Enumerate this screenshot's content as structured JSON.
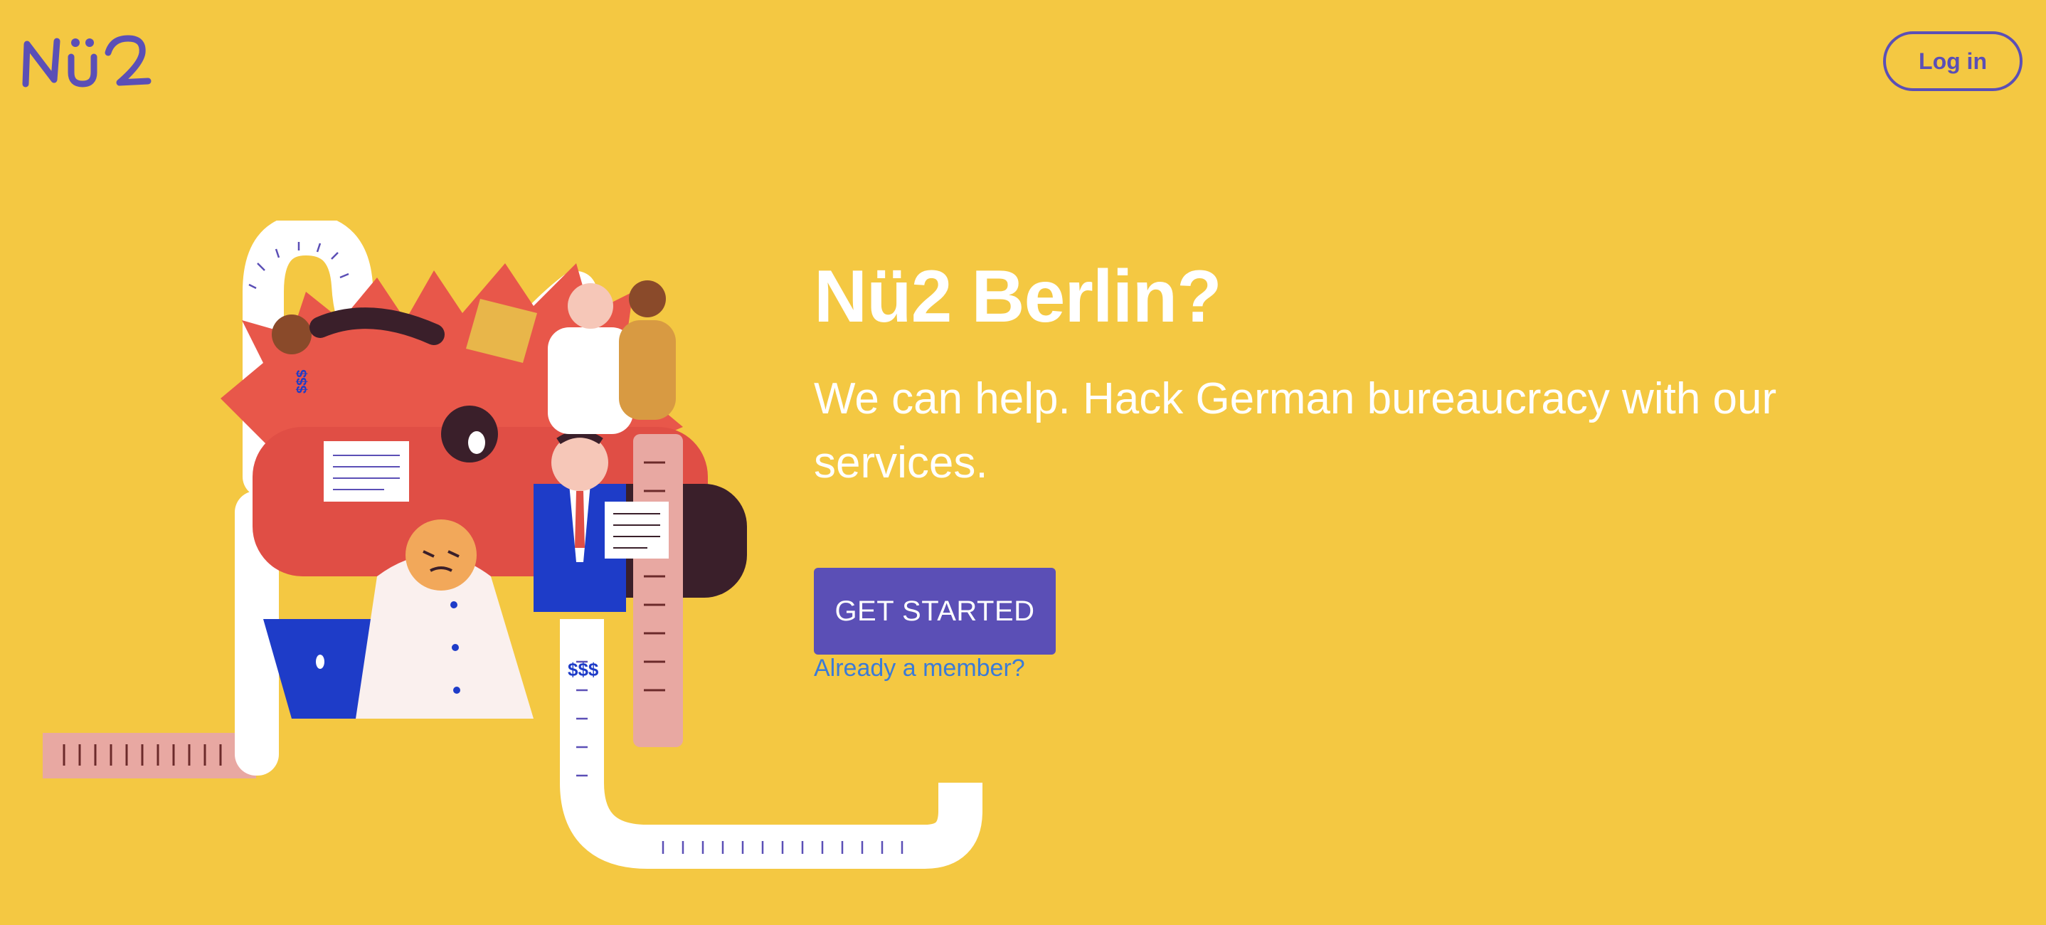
{
  "header": {
    "logo_text": "Nü2",
    "login_label": "Log in"
  },
  "hero": {
    "title": "Nü2 Berlin?",
    "subtitle": "We can help. Hack German bureaucracy with our services.",
    "cta_label": "GET STARTED",
    "member_link": "Already a member?"
  },
  "illustration": {
    "receipt_text_left": "$$$",
    "receipt_text_bottom": "$$$"
  },
  "colors": {
    "background": "#F4C842",
    "brand": "#5B4FB6",
    "link": "#3B7BD8",
    "text": "#FFFFFF"
  }
}
